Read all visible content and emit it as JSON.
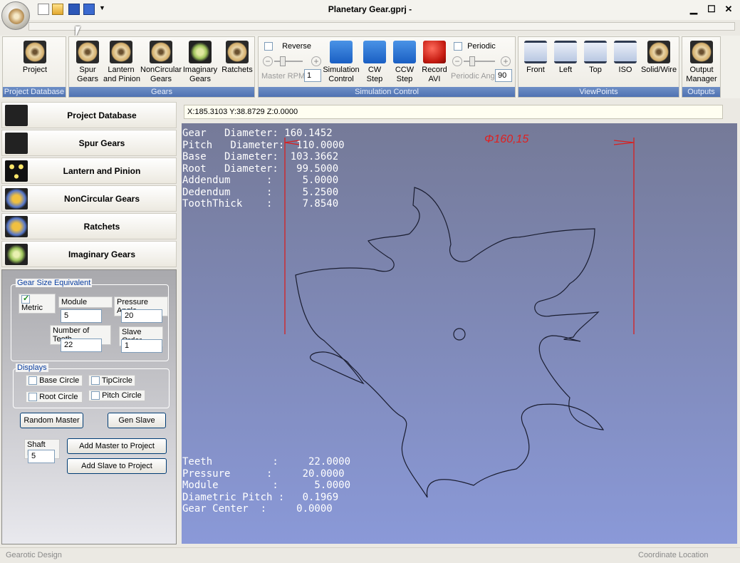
{
  "window": {
    "title": "Planetary Gear.gprj -",
    "minimize": "▁",
    "maximize": "☐",
    "close": "✕"
  },
  "ribbon": {
    "groups": {
      "project_database": "Project Database",
      "gears": "Gears",
      "simulation": "Simulation Control",
      "viewpoints": "ViewPoints",
      "outputs": "Outputs"
    },
    "project": "Project",
    "spur": "Spur\nGears",
    "lantern": "Lantern\nand Pinion",
    "noncircular": "NonCircular\nGears",
    "imaginary": "Imaginary\nGears",
    "ratchets": "Ratchets",
    "reverse": "Reverse",
    "master_rpm_label": "Master RPM",
    "master_rpm_value": "1",
    "sim_control": "Simulation\nControl",
    "cw_step": "CW\nStep",
    "ccw_step": "CCW\nStep",
    "record_avi": "Record\nAVI",
    "periodic": "Periodic",
    "periodic_ang_label": "Periodic Ang",
    "periodic_ang_value": "90",
    "front": "Front",
    "left": "Left",
    "top": "Top",
    "iso": "ISO",
    "solid_wire": "Solid/Wire",
    "output_manager": "Output\nManager"
  },
  "nav": [
    "Project Database",
    "Spur Gears",
    "Lantern and Pinion",
    "NonCircular Gears",
    "Ratchets",
    "Imaginary Gears"
  ],
  "props": {
    "gear_size_legend": "Gear Size Equivalent",
    "metric": "Metric",
    "module_label": "Module",
    "module_value": "5",
    "pressure_angle_label": "Pressure Angle",
    "pressure_angle_value": "20",
    "teeth_label": "Number of Teeth",
    "teeth_value": "22",
    "slave_order_label": "Slave Order",
    "slave_order_value": "1",
    "displays_legend": "Displays",
    "base_circle": "Base Circle",
    "tip_circle": "TipCircle",
    "root_circle": "Root Circle",
    "pitch_circle": "Pitch Circle",
    "random_master": "Random Master",
    "gen_slave": "Gen Slave",
    "shaft_dia_label": "Shaft Dia",
    "shaft_dia_value": "5",
    "add_master": "Add Master to Project",
    "add_slave": "Add Slave to Project"
  },
  "coords": "X:185.3103 Y:38.8729 Z:0.0000",
  "viewport": {
    "dimension": "Φ160,15",
    "info_top": "Gear   Diameter: 160.1452\nPitch   Diameter:  110.0000\nBase   Diameter:  103.3662\nRoot   Diameter:   99.5000\nAddendum      :     5.0000\nDedendum      :     5.2500\nToothThick    :     7.8540",
    "info_bottom": "Teeth          :     22.0000\nPressure      :     20.0000\nModule         :      5.0000\nDiametric Pitch :   0.1969\nGear Center  :     0.0000"
  },
  "status": {
    "left": "Gearotic Design",
    "right": "Coordinate Location"
  },
  "colors": {
    "ribbon_group_label": "#4f72b2",
    "dimension_red": "#e02020",
    "viewport_top": "#757a98",
    "viewport_bottom": "#8a99d8"
  }
}
